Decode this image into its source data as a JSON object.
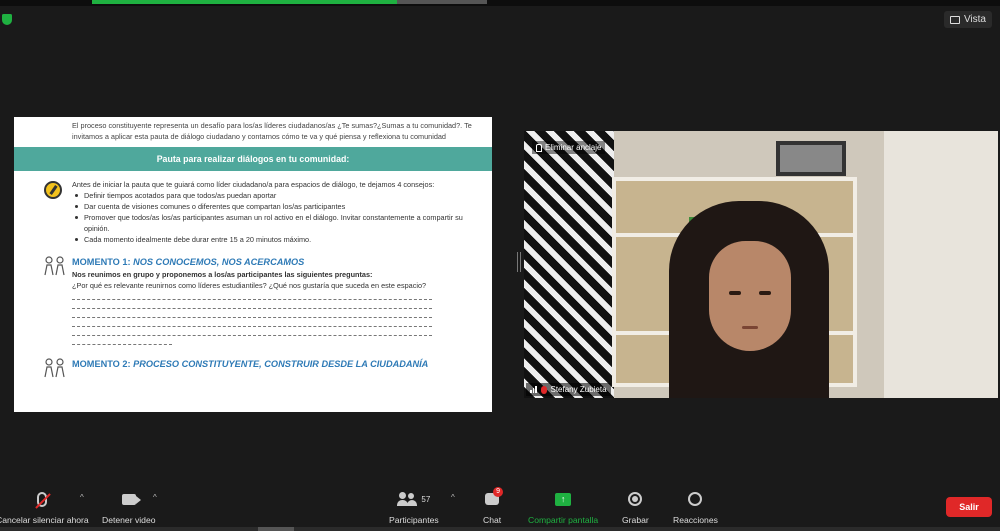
{
  "top_bar": {
    "view_label": "Vista"
  },
  "document": {
    "intro": "El proceso constituyente representa un desafío para los/as líderes ciudadanos/as ¿Te sumas?¿Sumas a tu comunidad?. Te invitamos a aplicar esta pauta de diálogo ciudadano y contarnos cómo te va y qué piensa y reflexiona tu comunidad",
    "banner": "Pauta para realizar diálogos en tu comunidad:",
    "tips_intro": "Antes de iniciar la pauta que te guiará como líder ciudadano/a para espacios de diálogo, te dejamos 4 consejos:",
    "tips": [
      "Definir tiempos acotados para que todos/as puedan aportar",
      "Dar cuenta de visiones comunes o diferentes que compartan los/as participantes",
      "Promover que todos/as los/as participantes asuman un rol activo en el diálogo. Invitar constantemente a compartir su opinión.",
      "Cada momento idealmente debe durar entre 15 a 20 minutos máximo."
    ],
    "moment1": {
      "prefix": "MOMENTO 1: ",
      "title": "NOS CONOCEMOS, NOS ACERCAMOS",
      "lead": "Nos reunimos en grupo y proponemos a los/as participantes las siguientes preguntas:",
      "question": "¿Por qué es relevante reunirnos como líderes estudiantiles? ¿Qué nos gustaría que suceda en este espacio?"
    },
    "moment2": {
      "prefix": "MOMENTO 2: ",
      "title": "PROCESO CONSTITUYENTE, CONSTRUIR DESDE LA CIUDADANÍA"
    }
  },
  "video": {
    "unpin_label": "Eliminar anclaje",
    "participant_name": "Stefany Zubieta"
  },
  "toolbar": {
    "unmute_label": "Cancelar silenciar ahora",
    "stop_video_label": "Detener video",
    "participants_label": "Participantes",
    "participants_count": "57",
    "chat_label": "Chat",
    "chat_badge": "9",
    "share_label": "Compartir pantalla",
    "record_label": "Grabar",
    "reactions_label": "Reacciones",
    "leave_label": "Salir"
  },
  "colors": {
    "accent_green": "#1fb141",
    "leave_red": "#e02828",
    "doc_banner": "#4fa89c",
    "moment_blue": "#2e7ab6"
  }
}
